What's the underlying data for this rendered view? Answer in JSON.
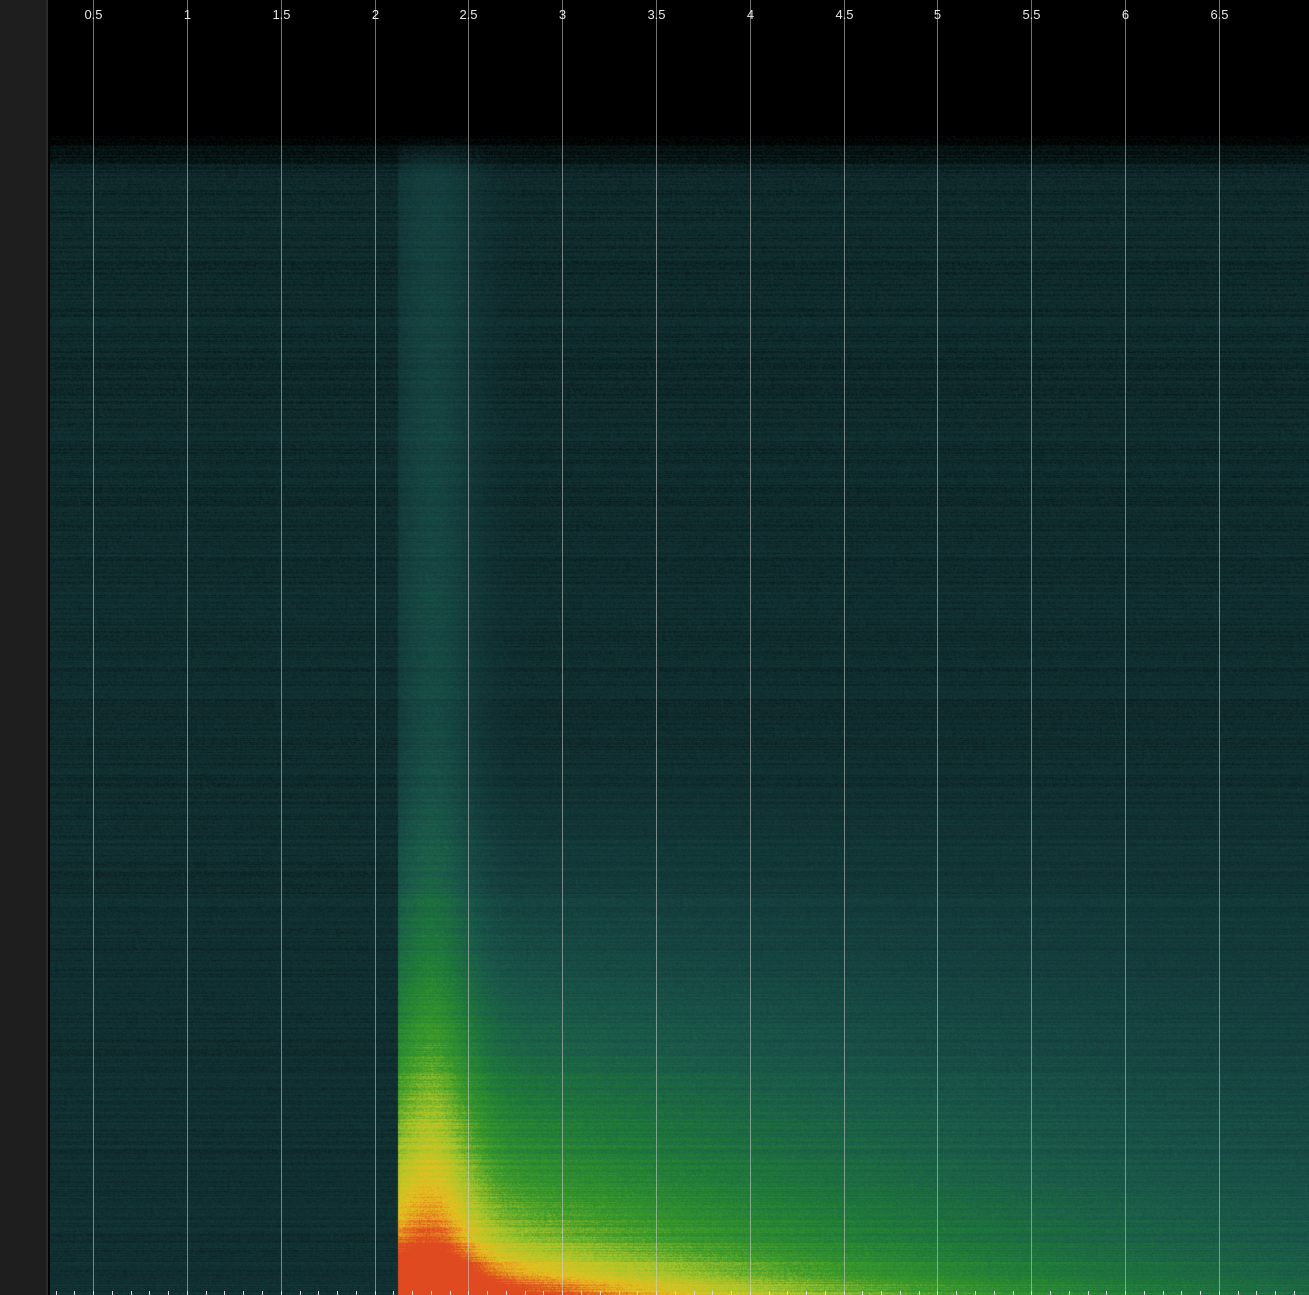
{
  "chart_data": {
    "type": "heatmap",
    "title": "",
    "xlabel": "",
    "ylabel": "",
    "x_ticks": [
      0.5,
      1,
      1.5,
      2,
      2.5,
      3,
      3.5,
      4,
      4.5,
      5,
      5.5,
      6,
      6.5
    ],
    "x_tick_labels": [
      "0.5",
      "1",
      "1.5",
      "2",
      "2.5",
      "3",
      "3.5",
      "4",
      "4.5",
      "5",
      "5.5",
      "6",
      "6.5"
    ],
    "xlim": [
      0.27,
      6.98
    ],
    "grid": true,
    "onset_x": 2.12,
    "noise_floor_top_y_fraction": 0.12,
    "colormap": [
      "#000000",
      "#0f2a2c",
      "#15403f",
      "#1a5a4a",
      "#1f7a3a",
      "#3a9a2a",
      "#a8c62a",
      "#e8c020",
      "#e04a20"
    ],
    "description_values": {
      "background_level": 0.12,
      "onset_column_level": 0.32,
      "peak_level_bottom": 1.0
    }
  }
}
